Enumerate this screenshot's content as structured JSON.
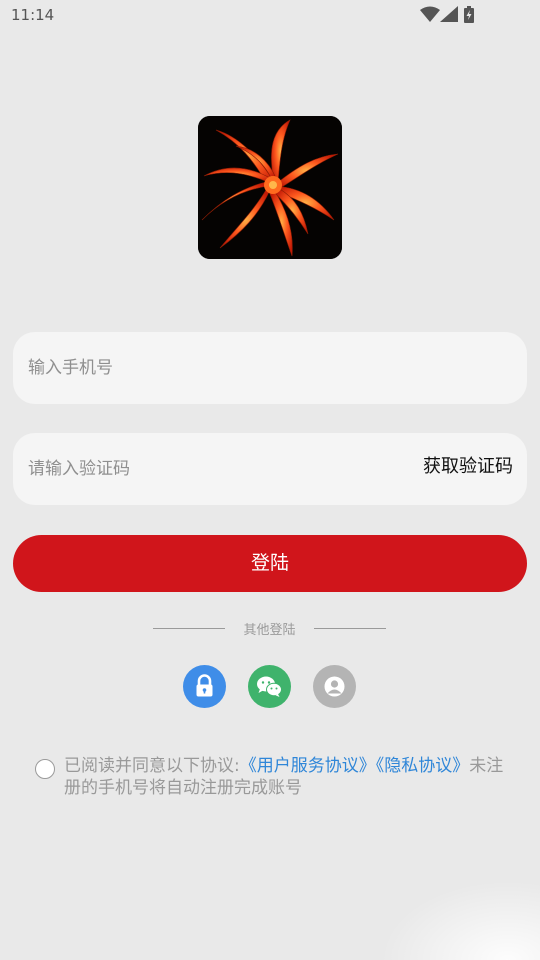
{
  "status_bar": {
    "time": "11:14",
    "icons": [
      "wifi-icon",
      "signal-icon",
      "battery-charging-icon"
    ]
  },
  "logo": {
    "icon": "red-flower-logo-icon"
  },
  "phone_field": {
    "placeholder": "输入手机号"
  },
  "code_field": {
    "placeholder": "请输入验证码",
    "get_code_label": "获取验证码"
  },
  "login_button": {
    "label": "登陆",
    "color": "#d0151b"
  },
  "other_login": {
    "label": "其他登陆",
    "options": [
      {
        "icon": "lock-icon",
        "color": "#3f8de8"
      },
      {
        "icon": "wechat-icon",
        "color": "#3fb36c"
      },
      {
        "icon": "guest-user-icon",
        "color": "#b4b4b4"
      }
    ]
  },
  "agreement": {
    "prefix": "已阅读并同意以下协议:",
    "user_agreement": "《用户服务协议》",
    "privacy_policy": "《隐私协议》",
    "suffix": "未注册的手机号将自动注册完成账号",
    "link_color": "#2f86d8"
  }
}
